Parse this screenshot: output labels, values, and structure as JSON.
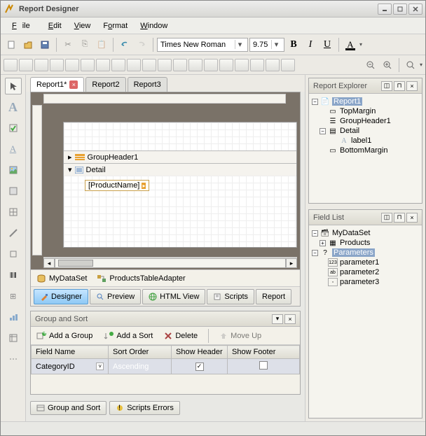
{
  "window": {
    "title": "Report Designer"
  },
  "menu": {
    "file": "File",
    "edit": "Edit",
    "view": "View",
    "format": "Format",
    "window": "Window"
  },
  "font": {
    "family": "Times New Roman",
    "size": "9.75",
    "bold": "B",
    "italic": "I",
    "underline": "U",
    "fontcolor": "A"
  },
  "tabs": [
    {
      "label": "Report1*",
      "closable": true,
      "active": true
    },
    {
      "label": "Report2",
      "closable": false,
      "active": false
    },
    {
      "label": "Report3",
      "closable": false,
      "active": false
    }
  ],
  "bands": {
    "groupheader": "GroupHeader1",
    "detail": "Detail",
    "field": "[ProductName]"
  },
  "datasources": {
    "ds": "MyDataSet",
    "ta": "ProductsTableAdapter"
  },
  "viewtabs": {
    "designer": "Designer",
    "preview": "Preview",
    "htmlview": "HTML View",
    "scripts": "Scripts",
    "report": "Report"
  },
  "groupsort": {
    "title": "Group and Sort",
    "addgroup": "Add a Group",
    "addsort": "Add a Sort",
    "delete": "Delete",
    "moveup": "Move Up",
    "cols": {
      "field": "Field Name",
      "order": "Sort Order",
      "showheader": "Show Header",
      "showfooter": "Show Footer"
    },
    "row": {
      "field": "CategoryID",
      "order": "Ascending",
      "showheader": true,
      "showfooter": false
    }
  },
  "bottomtabs": {
    "groupsort": "Group and Sort",
    "scriptserrors": "Scripts Errors"
  },
  "reportexplorer": {
    "title": "Report Explorer",
    "root": "Report1",
    "items": [
      "TopMargin",
      "GroupHeader1",
      "Detail",
      "label1",
      "BottomMargin"
    ]
  },
  "fieldlist": {
    "title": "Field List",
    "root": "MyDataSet",
    "products": "Products",
    "parameters": "Parameters",
    "params": [
      "parameter1",
      "parameter2",
      "parameter3"
    ]
  }
}
